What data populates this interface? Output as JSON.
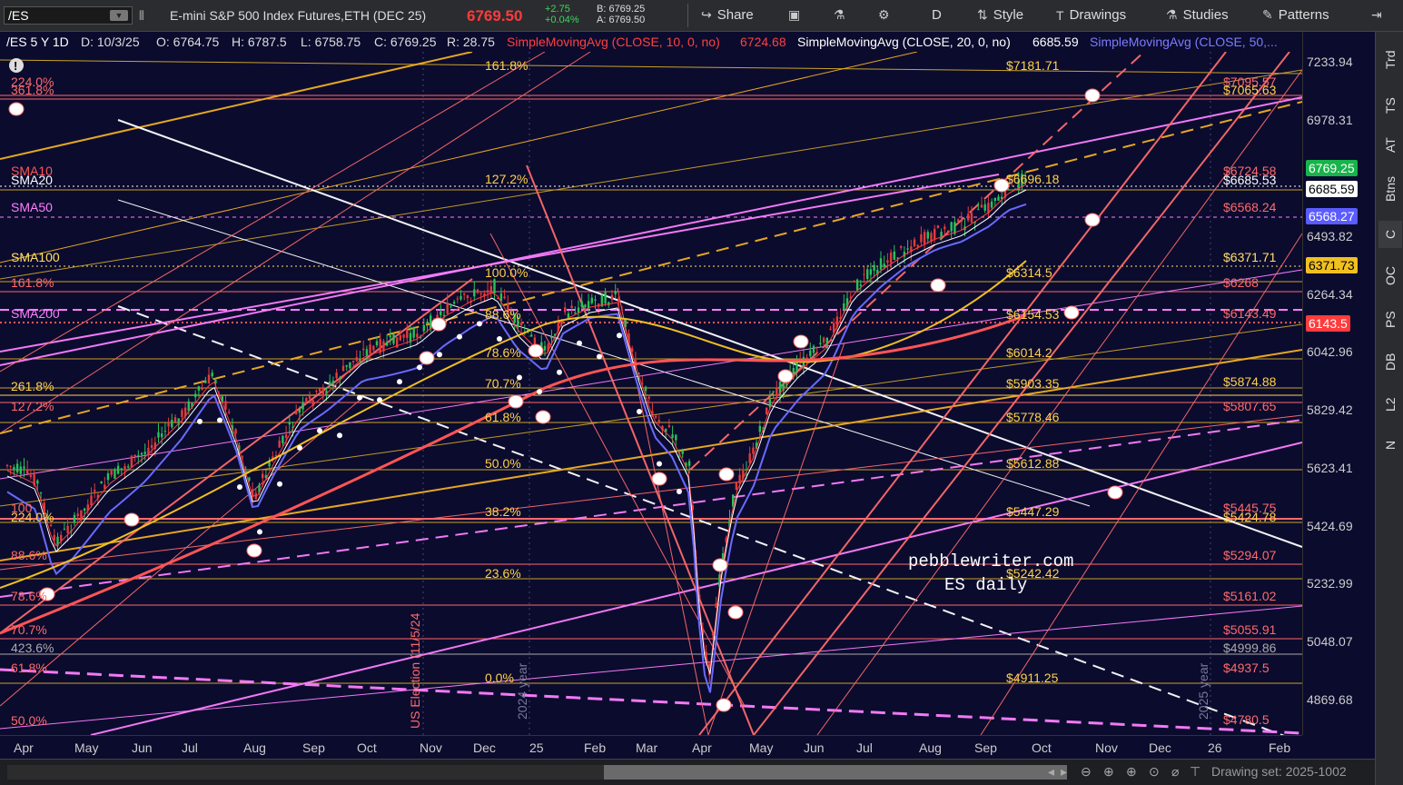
{
  "toolbar": {
    "symbol": "/ES",
    "title": "E-mini S&P 500 Index Futures,ETH (DEC 25)",
    "last": "6769.50",
    "change": "+2.75",
    "change_pct": "+0.04%",
    "bid": "B: 6769.25",
    "ask": "A: 6769.50",
    "share": "Share",
    "period": "D",
    "style": "Style",
    "drawings": "Drawings",
    "studies": "Studies",
    "patterns": "Patterns"
  },
  "info": {
    "desc": "/ES 5 Y 1D",
    "date": "D: 10/3/25",
    "open": "O: 6764.75",
    "high": "H: 6787.5",
    "low": "L: 6758.75",
    "close": "C: 6769.25",
    "range": "R: 28.75",
    "sma10": "SimpleMovingAvg (CLOSE, 10, 0, no)",
    "sma10v": "6724.68",
    "sma20": "SimpleMovingAvg (CLOSE, 20, 0, no)",
    "sma20v": "6685.59",
    "sma50": "SimpleMovingAvg (CLOSE, 50,..."
  },
  "yaxis": {
    "ticks": [
      "7233.94",
      "6978.31",
      "6493.82",
      "6264.34",
      "6042.96",
      "5829.42",
      "5623.41",
      "5424.69",
      "5232.99",
      "5048.07",
      "4869.68"
    ],
    "tags": [
      {
        "text": "6769.25",
        "bg": "#17b44b",
        "fg": "#ffffff"
      },
      {
        "text": "6685.59",
        "bg": "#ffffff",
        "fg": "#000000"
      },
      {
        "text": "6568.27",
        "bg": "#5b5bff",
        "fg": "#ffffff"
      },
      {
        "text": "6371.73",
        "bg": "#f0c020",
        "fg": "#000000"
      },
      {
        "text": "6143.5",
        "bg": "#ff3b3b",
        "fg": "#ffffff"
      }
    ]
  },
  "xaxis": [
    "Apr",
    "May",
    "Jun",
    "Jul",
    "Aug",
    "Sep",
    "Oct",
    "Nov",
    "Dec",
    "25",
    "Feb",
    "Mar",
    "Apr",
    "May",
    "Jun",
    "Jul",
    "Aug",
    "Sep",
    "Oct",
    "Nov",
    "Dec",
    "26",
    "Feb"
  ],
  "right_tabs": [
    "Trd",
    "TS",
    "AT",
    "Btns",
    "C",
    "OC",
    "PS",
    "DB",
    "L2",
    "N"
  ],
  "left_labels": [
    {
      "t": "224.0%",
      "c": "#ff6a6a"
    },
    {
      "t": "361.8%",
      "c": "#ff6a6a"
    },
    {
      "t": "SMA10",
      "c": "#ff5555"
    },
    {
      "t": "SMA20",
      "c": "#ffffff"
    },
    {
      "t": "SMA50",
      "c": "#ff7fff"
    },
    {
      "t": "SMA100",
      "c": "#ffe066"
    },
    {
      "t": "161.8%",
      "c": "#ff6a6a"
    },
    {
      "t": "SMA200",
      "c": "#ff7fff"
    },
    {
      "t": "261.8%",
      "c": "#ffd24a"
    },
    {
      "t": "127.2%",
      "c": "#ff6a6a"
    },
    {
      "t": "100",
      "c": "#ff6a6a"
    },
    {
      "t": "224.0%",
      "c": "#ffd24a"
    },
    {
      "t": "88.6%",
      "c": "#ff6a6a"
    },
    {
      "t": "78.6%",
      "c": "#ff6a6a"
    },
    {
      "t": "70.7%",
      "c": "#ff6a6a"
    },
    {
      "t": "423.6%",
      "c": "#aaaaaa"
    },
    {
      "t": "61.8%",
      "c": "#ff6a6a"
    },
    {
      "t": "50.0%",
      "c": "#ff6a6a"
    }
  ],
  "fib_left": [
    "161.8%",
    "127.2%",
    "100.0%",
    "88.6%",
    "78.6%",
    "70.7%",
    "61.8%",
    "50.0%",
    "38.2%",
    "23.6%",
    "0.0%"
  ],
  "fib_right": [
    "$7181.71",
    "$6696.18",
    "$6314.5",
    "$6154.53",
    "$6014.2",
    "$5903.35",
    "$5778.46",
    "$5612.88",
    "$5447.29",
    "$5242.42",
    "$4911.25"
  ],
  "right_levels": [
    "$7095.57",
    "$7065.63",
    "$6724.58",
    "$6685.53",
    "$6568.24",
    "$6371.71",
    "$6268",
    "$6143.49",
    "$5874.88",
    "$5807.65",
    "$5445.75",
    "$5424.78",
    "$5294.07",
    "$5161.02",
    "$5055.91",
    "$4999.86",
    "$4937.5",
    "$4780.5"
  ],
  "annotations": {
    "watermark1": "pebblewriter.com",
    "watermark2": "ES daily",
    "election": "US Election (11/5/24",
    "y2024": "2024 year",
    "y2025": "2025 year"
  },
  "status": {
    "drawing_set": "Drawing set: 2025-1002"
  }
}
